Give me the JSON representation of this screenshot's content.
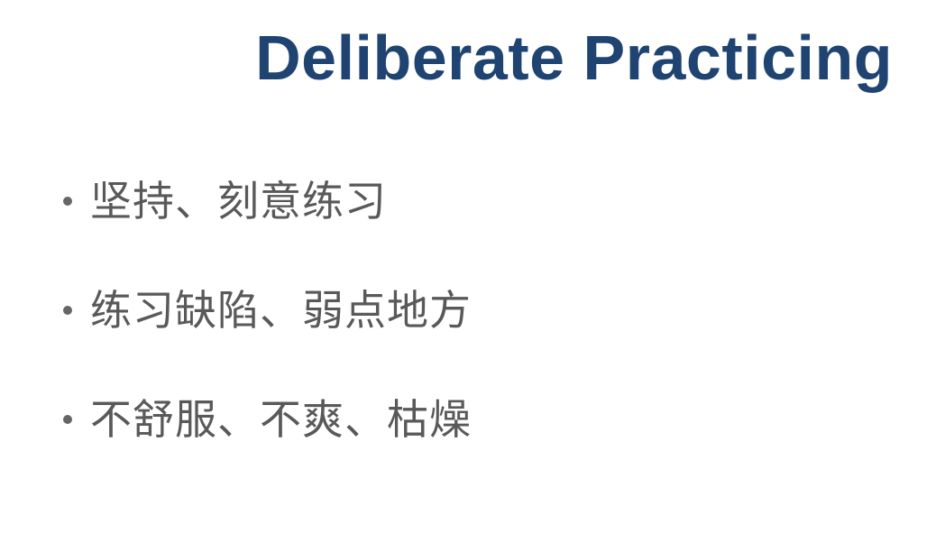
{
  "slide": {
    "title": "Deliberate Practicing",
    "bullets": [
      "坚持、刻意练习",
      "练习缺陷、弱点地方",
      "不舒服、不爽、枯燥"
    ]
  },
  "colors": {
    "title": "#1f4472",
    "text": "#595959",
    "bullet": "#666666",
    "background": "#ffffff"
  }
}
